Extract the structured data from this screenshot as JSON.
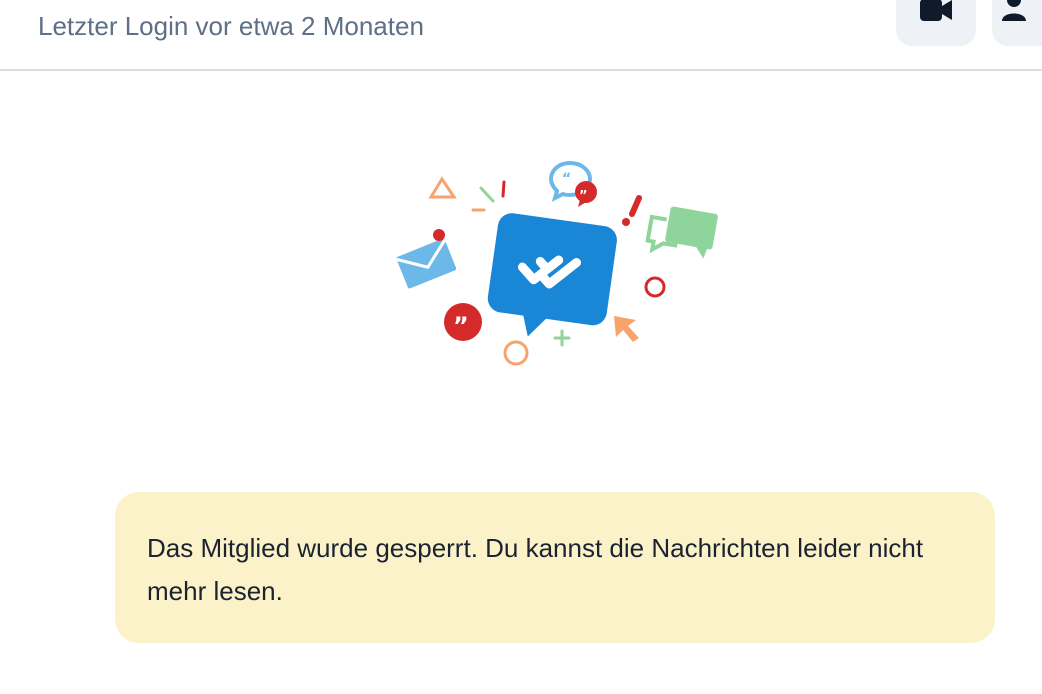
{
  "header": {
    "last_login": "Letzter Login vor etwa 2 Monaten",
    "video_icon": "video-camera-icon",
    "profile_icon": "user-icon"
  },
  "illustration": {
    "name": "empty-chat-illustration"
  },
  "notice": {
    "message": "Das Mitglied wurde gesperrt. Du kannst die Nachrichten leider nicht mehr lesen."
  },
  "colors": {
    "header_text": "#5f6f85",
    "notice_bg": "#fcf2c9",
    "notice_text": "#1b2330",
    "primary_blue": "#1a87d6",
    "red": "#d42a2a",
    "green": "#8fd49a",
    "orange": "#f7a36b",
    "light_blue": "#6cb8e8"
  }
}
